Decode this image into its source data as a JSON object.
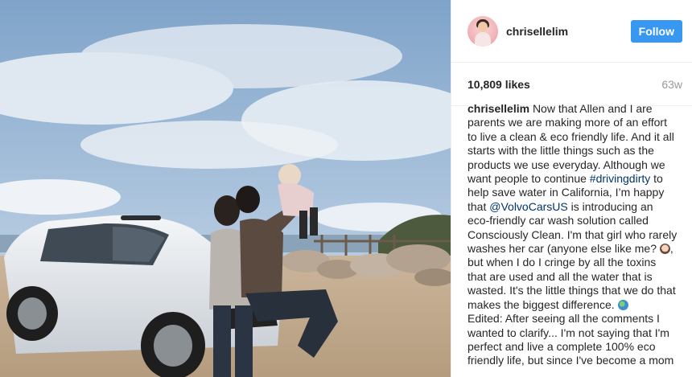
{
  "author": {
    "username": "chrisellelim",
    "follow_label": "Follow"
  },
  "stats": {
    "likes": "10,809 likes",
    "age": "63w"
  },
  "caption": {
    "username": "chrisellelim",
    "text_1": "Now that Allen and I are parents we are making more of an effort to live a clean & eco friendly life. And it all starts with the little things such as the products we use everyday. Although we want people to continue ",
    "hashtag": "#drivingdirty",
    "text_2": " to help save water in California, I’m happy that ",
    "mention": "@VolvoCarsUS",
    "text_3": " is introducing an eco-friendly car wash solution called Consciously Clean. I'm that girl who rarely washes her car (anyone else like me? ",
    "text_4": ", but when I do I cringe by all the toxins that are used and all the water that is wasted. It's the little things that we do that makes the biggest difference. ",
    "edited": "Edited: After seeing all the comments I wanted to clarify... I'm not saying that I'm perfect and live a complete 100% eco friendly life, but since I've become a mom"
  },
  "icons": {
    "emoji_1": "woman-facepalm-emoji",
    "emoji_2": "earth-globe-emoji"
  },
  "colors": {
    "follow_button": "#3897f0",
    "text": "#262626",
    "link": "#003569",
    "muted": "#999999"
  }
}
